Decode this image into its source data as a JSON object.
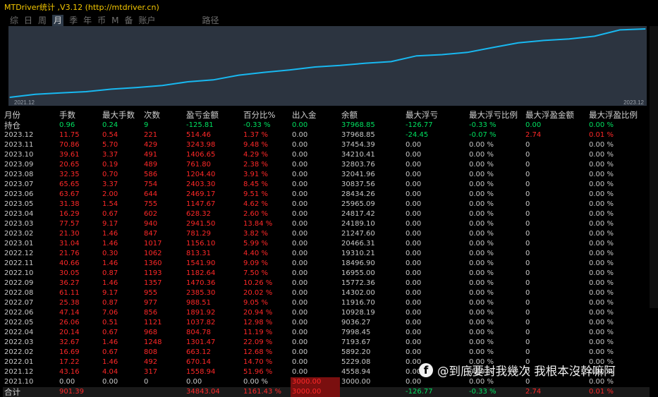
{
  "title": "MTDriver统计 ,V3.12 (http://mtdriver.cn)",
  "tabs": [
    "综",
    "日",
    "周",
    "月",
    "季",
    "年",
    "币",
    "M",
    "备",
    "账户",
    "路径"
  ],
  "active_tab": "月",
  "chart_data": {
    "type": "line",
    "x_start_label": "2021.12",
    "x_end_label": "2023.12",
    "x": [
      "2021.10",
      "2021.12",
      "2022.01",
      "2022.02",
      "2022.03",
      "2022.04",
      "2022.05",
      "2022.06",
      "2022.07",
      "2022.08",
      "2022.09",
      "2022.10",
      "2022.11",
      "2022.12",
      "2023.01",
      "2023.02",
      "2023.03",
      "2023.04",
      "2023.05",
      "2023.06",
      "2023.07",
      "2023.08",
      "2023.09",
      "2023.10",
      "2023.11",
      "2023.12"
    ],
    "values": [
      3000.0,
      4558.94,
      5229.08,
      5892.2,
      7193.67,
      7998.45,
      9036.27,
      10928.19,
      11916.7,
      14302.0,
      15772.36,
      16955.0,
      18496.9,
      19310.21,
      20466.31,
      21247.6,
      24189.1,
      24817.42,
      25965.09,
      28434.26,
      30837.56,
      32041.96,
      32803.76,
      34210.41,
      37454.39,
      37968.85
    ],
    "line_color": "#18b8f0",
    "background": "#2c3440"
  },
  "table": {
    "headers": [
      "月份",
      "手数",
      "最大手数",
      "次数",
      "盈亏金额",
      "百分比%",
      "出入金",
      "余额",
      "最大浮亏",
      "最大浮亏比例",
      "最大浮盈金额",
      "最大浮盈比例"
    ],
    "holding": [
      "持仓",
      "0.96",
      "0.24",
      "9",
      "-125.81",
      "-0.33 %",
      "0.00",
      "37968.85",
      "-126.77",
      "-0.33 %",
      "0.00",
      "0.00 %"
    ],
    "rows": [
      [
        "2023.12",
        "11.75",
        "0.54",
        "221",
        "514.46",
        "1.37 %",
        "0.00",
        "37968.85",
        "-24.45",
        "-0.07 %",
        "2.74",
        "0.01 %"
      ],
      [
        "2023.11",
        "70.86",
        "5.70",
        "429",
        "3243.98",
        "9.48 %",
        "0.00",
        "37454.39",
        "0.00",
        "0.00 %",
        "0",
        "0.00 %"
      ],
      [
        "2023.10",
        "39.61",
        "3.37",
        "491",
        "1406.65",
        "4.29 %",
        "0.00",
        "34210.41",
        "0.00",
        "0.00 %",
        "0",
        "0.00 %"
      ],
      [
        "2023.09",
        "20.65",
        "0.19",
        "489",
        "761.80",
        "2.38 %",
        "0.00",
        "32803.76",
        "0.00",
        "0.00 %",
        "0",
        "0.00 %"
      ],
      [
        "2023.08",
        "32.35",
        "0.70",
        "586",
        "1204.40",
        "3.91 %",
        "0.00",
        "32041.96",
        "0.00",
        "0.00 %",
        "0",
        "0.00 %"
      ],
      [
        "2023.07",
        "65.65",
        "3.37",
        "754",
        "2403.30",
        "8.45 %",
        "0.00",
        "30837.56",
        "0.00",
        "0.00 %",
        "0",
        "0.00 %"
      ],
      [
        "2023.06",
        "63.67",
        "2.00",
        "644",
        "2469.17",
        "9.51 %",
        "0.00",
        "28434.26",
        "0.00",
        "0.00 %",
        "0",
        "0.00 %"
      ],
      [
        "2023.05",
        "31.38",
        "1.54",
        "755",
        "1147.67",
        "4.62 %",
        "0.00",
        "25965.09",
        "0.00",
        "0.00 %",
        "0",
        "0.00 %"
      ],
      [
        "2023.04",
        "16.29",
        "0.67",
        "602",
        "628.32",
        "2.60 %",
        "0.00",
        "24817.42",
        "0.00",
        "0.00 %",
        "0",
        "0.00 %"
      ],
      [
        "2023.03",
        "77.57",
        "9.17",
        "940",
        "2941.50",
        "13.84 %",
        "0.00",
        "24189.10",
        "0.00",
        "0.00 %",
        "0",
        "0.00 %"
      ],
      [
        "2023.02",
        "21.30",
        "1.46",
        "847",
        "781.29",
        "3.82 %",
        "0.00",
        "21247.60",
        "0.00",
        "0.00 %",
        "0",
        "0.00 %"
      ],
      [
        "2023.01",
        "31.04",
        "1.46",
        "1017",
        "1156.10",
        "5.99 %",
        "0.00",
        "20466.31",
        "0.00",
        "0.00 %",
        "0",
        "0.00 %"
      ],
      [
        "2022.12",
        "21.76",
        "0.30",
        "1062",
        "813.31",
        "4.40 %",
        "0.00",
        "19310.21",
        "0.00",
        "0.00 %",
        "0",
        "0.00 %"
      ],
      [
        "2022.11",
        "40.66",
        "1.46",
        "1360",
        "1541.90",
        "9.09 %",
        "0.00",
        "18496.90",
        "0.00",
        "0.00 %",
        "0",
        "0.00 %"
      ],
      [
        "2022.10",
        "30.05",
        "0.87",
        "1193",
        "1182.64",
        "7.50 %",
        "0.00",
        "16955.00",
        "0.00",
        "0.00 %",
        "0",
        "0.00 %"
      ],
      [
        "2022.09",
        "36.27",
        "1.46",
        "1357",
        "1470.36",
        "10.26 %",
        "0.00",
        "15772.36",
        "0.00",
        "0.00 %",
        "0",
        "0.00 %"
      ],
      [
        "2022.08",
        "61.11",
        "9.17",
        "955",
        "2385.30",
        "20.02 %",
        "0.00",
        "14302.00",
        "0.00",
        "0.00 %",
        "0",
        "0.00 %"
      ],
      [
        "2022.07",
        "25.38",
        "0.87",
        "977",
        "988.51",
        "9.05 %",
        "0.00",
        "11916.70",
        "0.00",
        "0.00 %",
        "0",
        "0.00 %"
      ],
      [
        "2022.06",
        "47.14",
        "7.06",
        "856",
        "1891.92",
        "20.94 %",
        "0.00",
        "10928.19",
        "0.00",
        "0.00 %",
        "0",
        "0.00 %"
      ],
      [
        "2022.05",
        "26.06",
        "0.51",
        "1121",
        "1037.82",
        "12.98 %",
        "0.00",
        "9036.27",
        "0.00",
        "0.00 %",
        "0",
        "0.00 %"
      ],
      [
        "2022.04",
        "20.14",
        "0.67",
        "968",
        "804.78",
        "11.19 %",
        "0.00",
        "7998.45",
        "0.00",
        "0.00 %",
        "0",
        "0.00 %"
      ],
      [
        "2022.03",
        "32.67",
        "1.46",
        "1248",
        "1301.47",
        "22.09 %",
        "0.00",
        "7193.67",
        "0.00",
        "0.00 %",
        "0",
        "0.00 %"
      ],
      [
        "2022.02",
        "16.69",
        "0.67",
        "808",
        "663.12",
        "12.68 %",
        "0.00",
        "5892.20",
        "0.00",
        "0.00 %",
        "0",
        "0.00 %"
      ],
      [
        "2022.01",
        "17.22",
        "1.46",
        "492",
        "670.14",
        "14.70 %",
        "0.00",
        "5229.08",
        "0.00",
        "0.00 %",
        "0",
        "0.00 %"
      ],
      [
        "2021.12",
        "43.16",
        "4.04",
        "317",
        "1558.94",
        "51.96 %",
        "0.00",
        "4558.94",
        "0.00",
        "0.00 %",
        "0",
        "0.00 %"
      ],
      [
        "2021.10",
        "0.00",
        "0.00",
        "0",
        "0.00",
        "0.00 %",
        "3000.00",
        "3000.00",
        "0.00",
        "0.00 %",
        "0",
        "0.00 %"
      ]
    ],
    "total": [
      "合计",
      "901.39",
      "",
      "",
      "34843.04",
      "1161.43 %",
      "3000.00",
      "",
      "-126.77",
      "-0.33 %",
      "2.74",
      "0.01 %"
    ]
  },
  "watermark": {
    "icon": "facebook-icon",
    "text": "@到底要封我幾次 我根本沒幹嘛阿"
  }
}
